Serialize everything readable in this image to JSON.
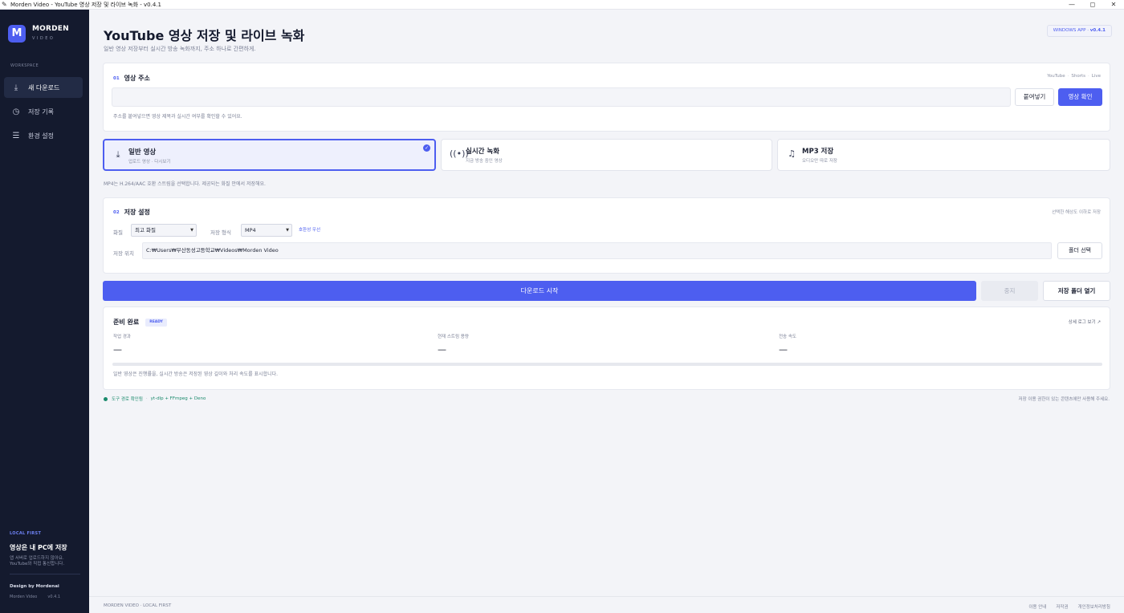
{
  "window": {
    "title": "Morden Video - YouTube 영상 저장 및 라이브 녹화 - v0.4.1",
    "controls": [
      "—",
      "◻",
      "✕"
    ]
  },
  "sidebar": {
    "brand_name": "MORDEN",
    "brand_sub": "VIDEO",
    "section_label": "WORKSPACE",
    "items": [
      {
        "label": "새 다운로드",
        "icon": "download-icon"
      },
      {
        "label": "저장 기록",
        "icon": "clock-icon"
      },
      {
        "label": "환경 설정",
        "icon": "sliders-icon"
      }
    ],
    "footer_tag": "LOCAL FIRST",
    "footer_head": "영상은 내 PC에 저장",
    "footer_desc": "앱 서버로 업로드하지 않아요. YouTube와 직접 통신합니다.",
    "design_credit": "Design by Mordenai",
    "app_name": "Morden Video",
    "app_version": "v0.4.1"
  },
  "header": {
    "title": "YouTube 영상 저장 및 라이브 녹화",
    "subtitle": "일반 영상 저장부터 실시간 방송 녹화까지, 주소 하나로 간편하게.",
    "badge_label": "WINDOWS APP",
    "badge_sep": "·",
    "badge_version": "v0.4.1"
  },
  "url_card": {
    "num": "01",
    "title": "영상 주소",
    "platforms": [
      "YouTube",
      "Shorts",
      "Live"
    ],
    "input_value": "",
    "paste_label": "붙여넣기",
    "check_label": "영상 확인",
    "hint": "주소를 붙여넣으면 영상 제목과 실시간 여부를 확인할 수 있어요."
  },
  "modes": [
    {
      "title": "일반 영상",
      "sub": "업로드 영상 · 다시보기",
      "icon": "download-icon",
      "selected": true
    },
    {
      "title": "실시간 녹화",
      "sub": "지금 방송 중인 영상",
      "icon": "broadcast-icon",
      "selected": false
    },
    {
      "title": "MP3 저장",
      "sub": "오디오만 따로 저장",
      "icon": "music-note-icon",
      "selected": false
    }
  ],
  "format_note": "MP4는 H.264/AAC 호환 스트림을 선택합니다. 제공되는 화질 안에서 저장해요.",
  "settings_card": {
    "num": "02",
    "title": "저장 설정",
    "right_note": "선택한 해상도 이하로 저장",
    "quality_label": "화질",
    "quality_value": "최고 화질",
    "format_label": "저장 형식",
    "format_value": "MP4",
    "compat_note": "호환성 우선",
    "path_label": "저장 위치",
    "path_value": "C:₩Users₩부산동성고등학교₩Videos₩Morden Video",
    "folder_button": "폴더 선택"
  },
  "actions": {
    "start": "다운로드 시작",
    "stop": "중지",
    "open_folder": "저장 폴더 열기"
  },
  "status_card": {
    "status": "준비 완료",
    "badge": "READY",
    "log_link": "상세 로그 보기 ↗",
    "stats": [
      {
        "label": "작업 경과",
        "value": "—"
      },
      {
        "label": "현재 스트림 용량",
        "value": "—"
      },
      {
        "label": "전송 속도",
        "value": "—"
      }
    ],
    "progress": 0,
    "info": "일반 영상은 진행률을, 실시간 방송은 저장된 영상 길이와 처리 속도를 표시합니다."
  },
  "tools": {
    "status": "도구 경로 확인됨",
    "sep": "·",
    "list": "yt-dlp + FFmpeg + Deno"
  },
  "notice": "저장 이용 권한이 있는 콘텐츠에만 사용해 주세요.",
  "footer": {
    "left": "MORDEN VIDEO · LOCAL FIRST",
    "links": [
      "이용 안내",
      "저작권",
      "개인정보처리방침"
    ]
  },
  "colors": {
    "accent": "#4d5ef0",
    "sidebar_bg": "#141a2e",
    "page_bg": "#f3f4f8",
    "ok_green": "#1a8a6c"
  }
}
